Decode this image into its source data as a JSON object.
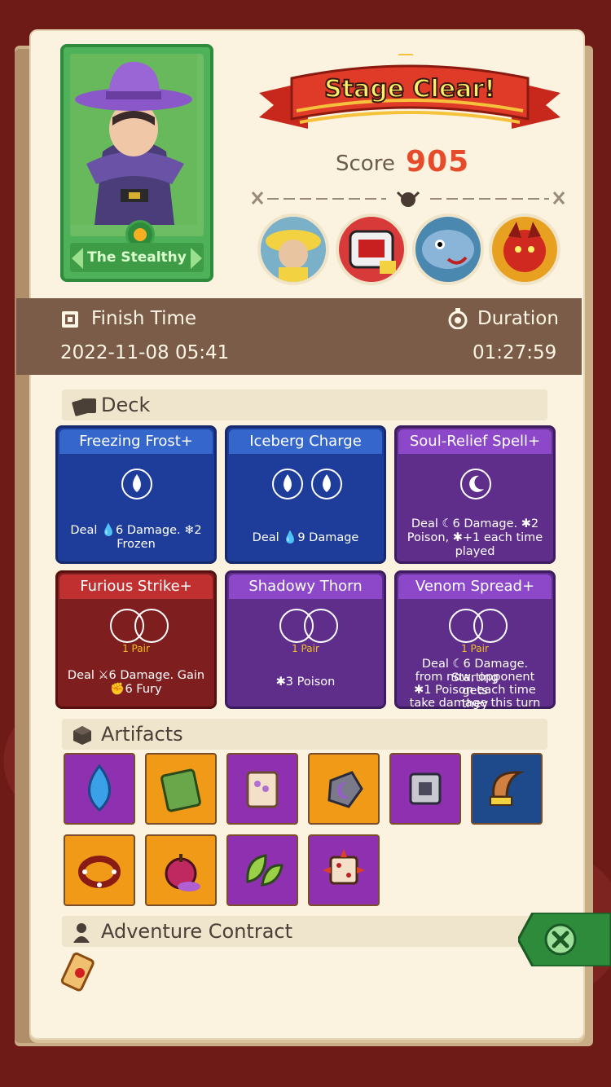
{
  "hero": {
    "name": "The Stealthy"
  },
  "result": {
    "banner": "Stage Clear!",
    "score_label": "Score",
    "score_value": "905"
  },
  "info": {
    "finish_time_label": "Finish Time",
    "finish_time_value": "2022-11-08 05:41",
    "duration_label": "Duration",
    "duration_value": "01:27:59"
  },
  "sections": {
    "deck": "Deck",
    "artifacts": "Artifacts",
    "contract": "Adventure Contract"
  },
  "cards": [
    {
      "title": "Freezing Frost+",
      "color": "blue",
      "desc_l1": "Deal 💧6 Damage. ❄2",
      "desc_l2": "Frozen"
    },
    {
      "title": "Iceberg Charge",
      "color": "blue",
      "desc_l1": "Deal 💧9 Damage"
    },
    {
      "title": "Soul-Relief Spell+",
      "color": "purple",
      "desc_l1": "Deal ☾6 Damage. ✱2",
      "desc_l2": "Poison, ✱+1 each time",
      "desc_l3": "played"
    },
    {
      "title": "Furious Strike+",
      "color": "red",
      "pair": "1 Pair",
      "desc_l1": "Deal ⚔6 Damage. Gain",
      "desc_l2": "✊6 Fury"
    },
    {
      "title": "Shadowy Thorn",
      "color": "purple",
      "pair": "1 Pair",
      "desc_l1": "✱3 Poison"
    },
    {
      "title": "Venom Spread+",
      "color": "purple",
      "pair": "1 Pair",
      "desc_l1": "Deal ☾6 Damage. Starting",
      "desc_l2": "from now, opponent gets",
      "desc_l3": "✱1 Poison each time they",
      "desc_l4": "take damage this turn"
    }
  ],
  "artifacts": [
    {
      "icon": "water-drop-icon",
      "bg": "purple"
    },
    {
      "icon": "green-mossy-tablet-icon",
      "bg": "orange"
    },
    {
      "icon": "scroll-icon",
      "bg": "purple"
    },
    {
      "icon": "moon-stone-icon",
      "bg": "orange"
    },
    {
      "icon": "metal-cube-icon",
      "bg": "purple"
    },
    {
      "icon": "horn-icon",
      "bg": "blue"
    },
    {
      "icon": "spiked-collar-icon",
      "bg": "orange"
    },
    {
      "icon": "rotten-apple-icon",
      "bg": "orange"
    },
    {
      "icon": "leaf-icon",
      "bg": "purple"
    },
    {
      "icon": "spiked-die-icon",
      "bg": "purple"
    }
  ]
}
